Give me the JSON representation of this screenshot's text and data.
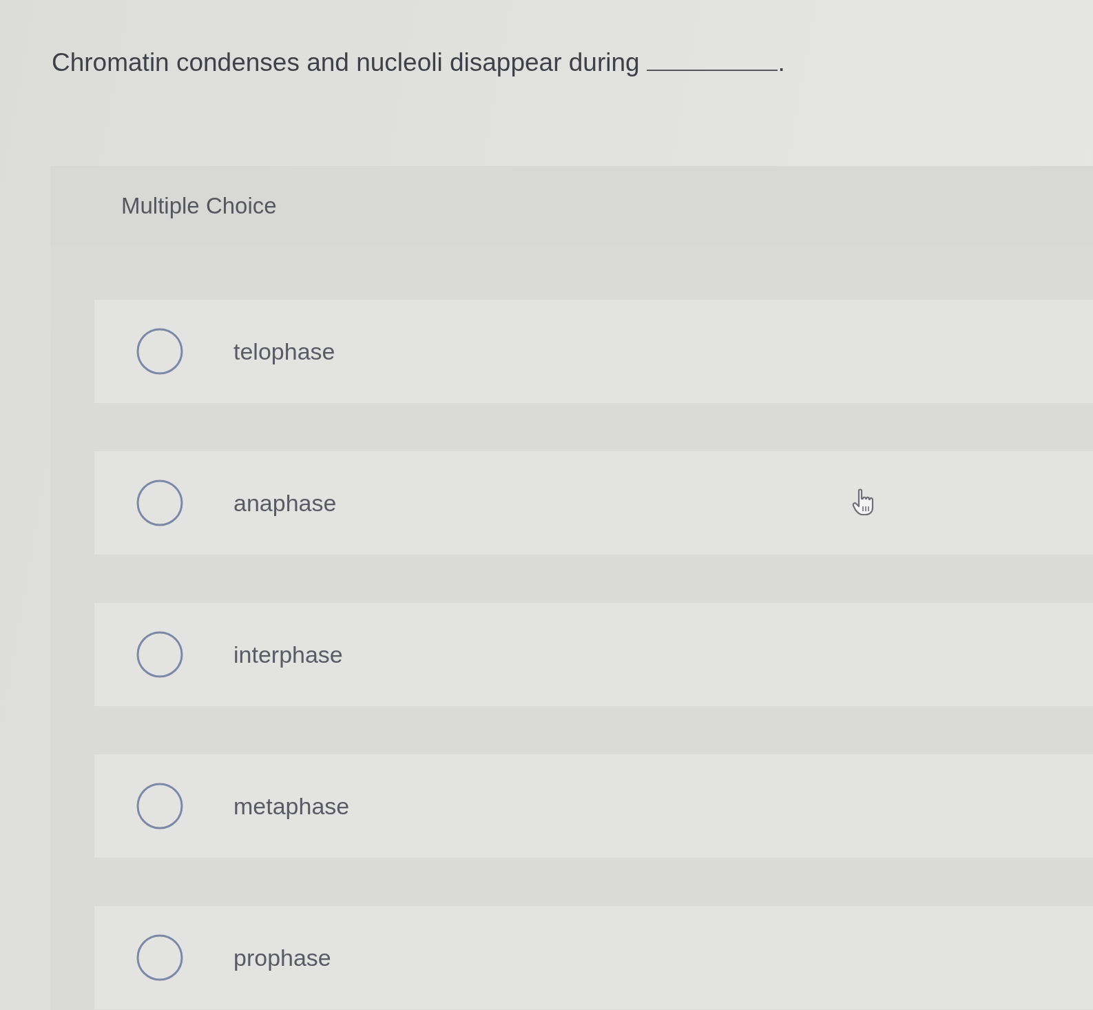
{
  "question": {
    "text": "Chromatin condenses and nucleoli disappear during",
    "after_blank": "."
  },
  "section_label": "Multiple Choice",
  "options": [
    {
      "label": "telophase",
      "selected": false
    },
    {
      "label": "anaphase",
      "selected": false
    },
    {
      "label": "interphase",
      "selected": false
    },
    {
      "label": "metaphase",
      "selected": false
    },
    {
      "label": "prophase",
      "selected": false
    }
  ]
}
